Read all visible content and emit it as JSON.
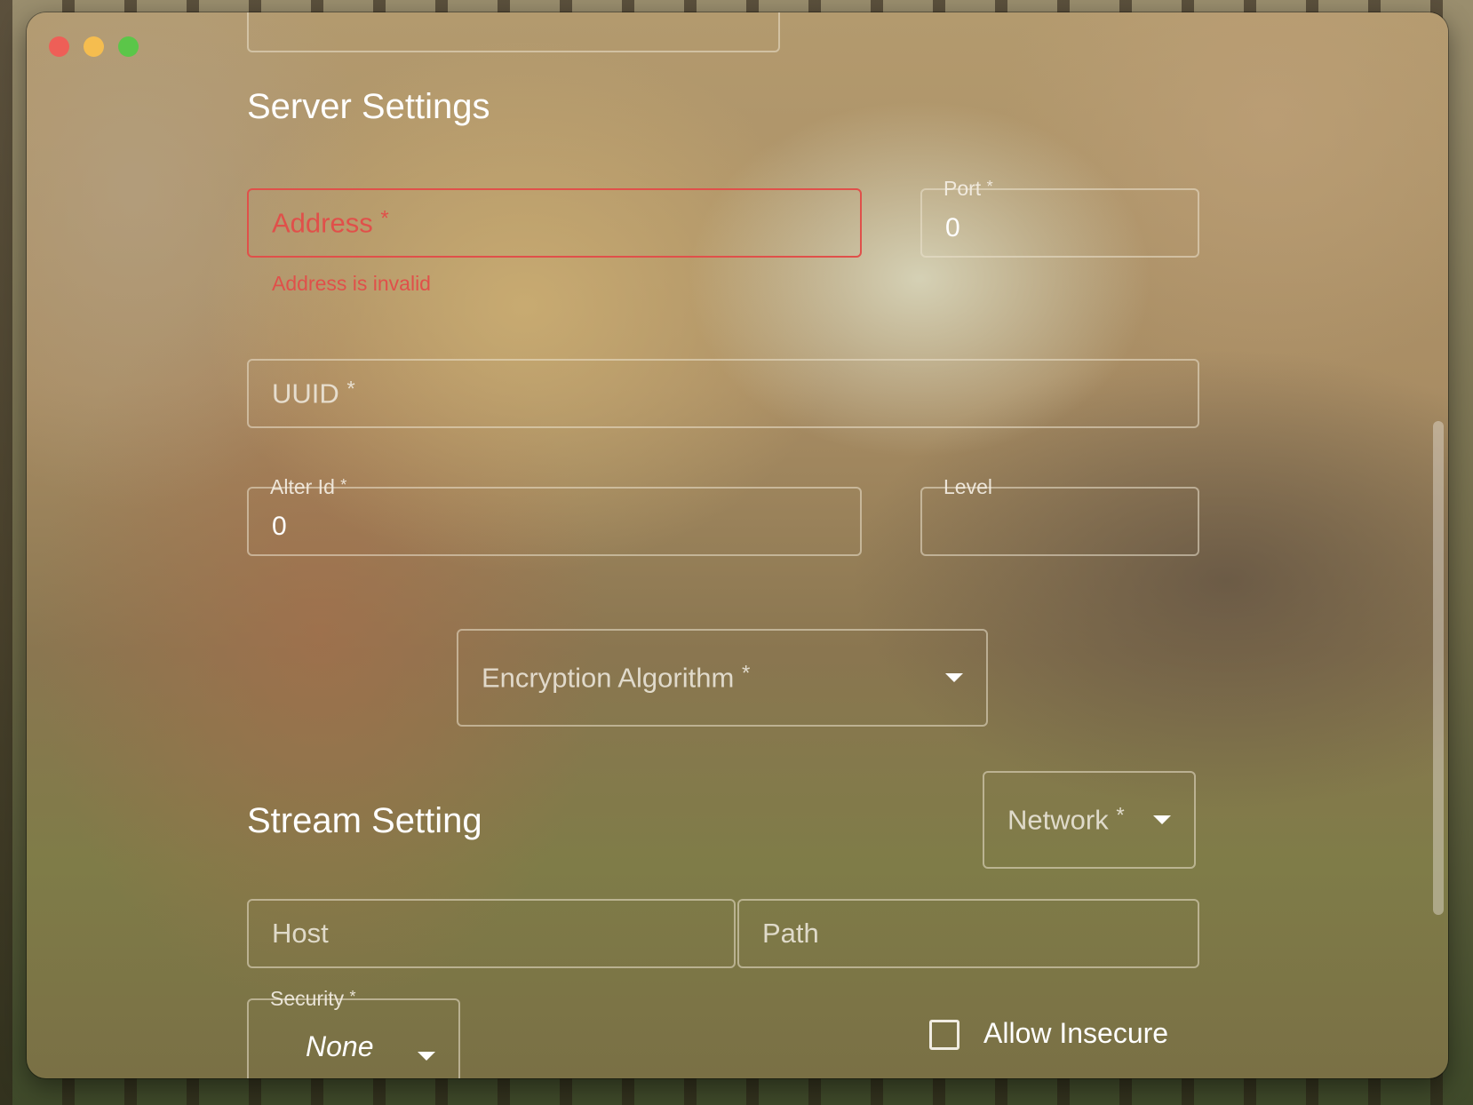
{
  "server_settings": {
    "heading": "Server Settings",
    "address": {
      "label": "Address",
      "required": "*",
      "error": "Address is invalid"
    },
    "port": {
      "label": "Port",
      "required": "*",
      "value": "0"
    },
    "uuid": {
      "label": "UUID",
      "required": "*"
    },
    "alter_id": {
      "label": "Alter Id",
      "required": "*",
      "value": "0"
    },
    "level": {
      "label": "Level"
    },
    "encryption": {
      "label": "Encryption Algorithm",
      "required": "*"
    }
  },
  "stream_setting": {
    "heading": "Stream Setting",
    "network": {
      "label": "Network",
      "required": "*"
    },
    "host": {
      "label": "Host"
    },
    "path": {
      "label": "Path"
    },
    "security": {
      "label": "Security",
      "required": "*",
      "value": "None"
    },
    "allow_insecure": {
      "label": "Allow Insecure",
      "checked": false
    }
  },
  "colors": {
    "error": "#e0504a",
    "traffic_close": "#ee5f57",
    "traffic_minimize": "#f5bd4f",
    "traffic_zoom": "#5bc649"
  }
}
